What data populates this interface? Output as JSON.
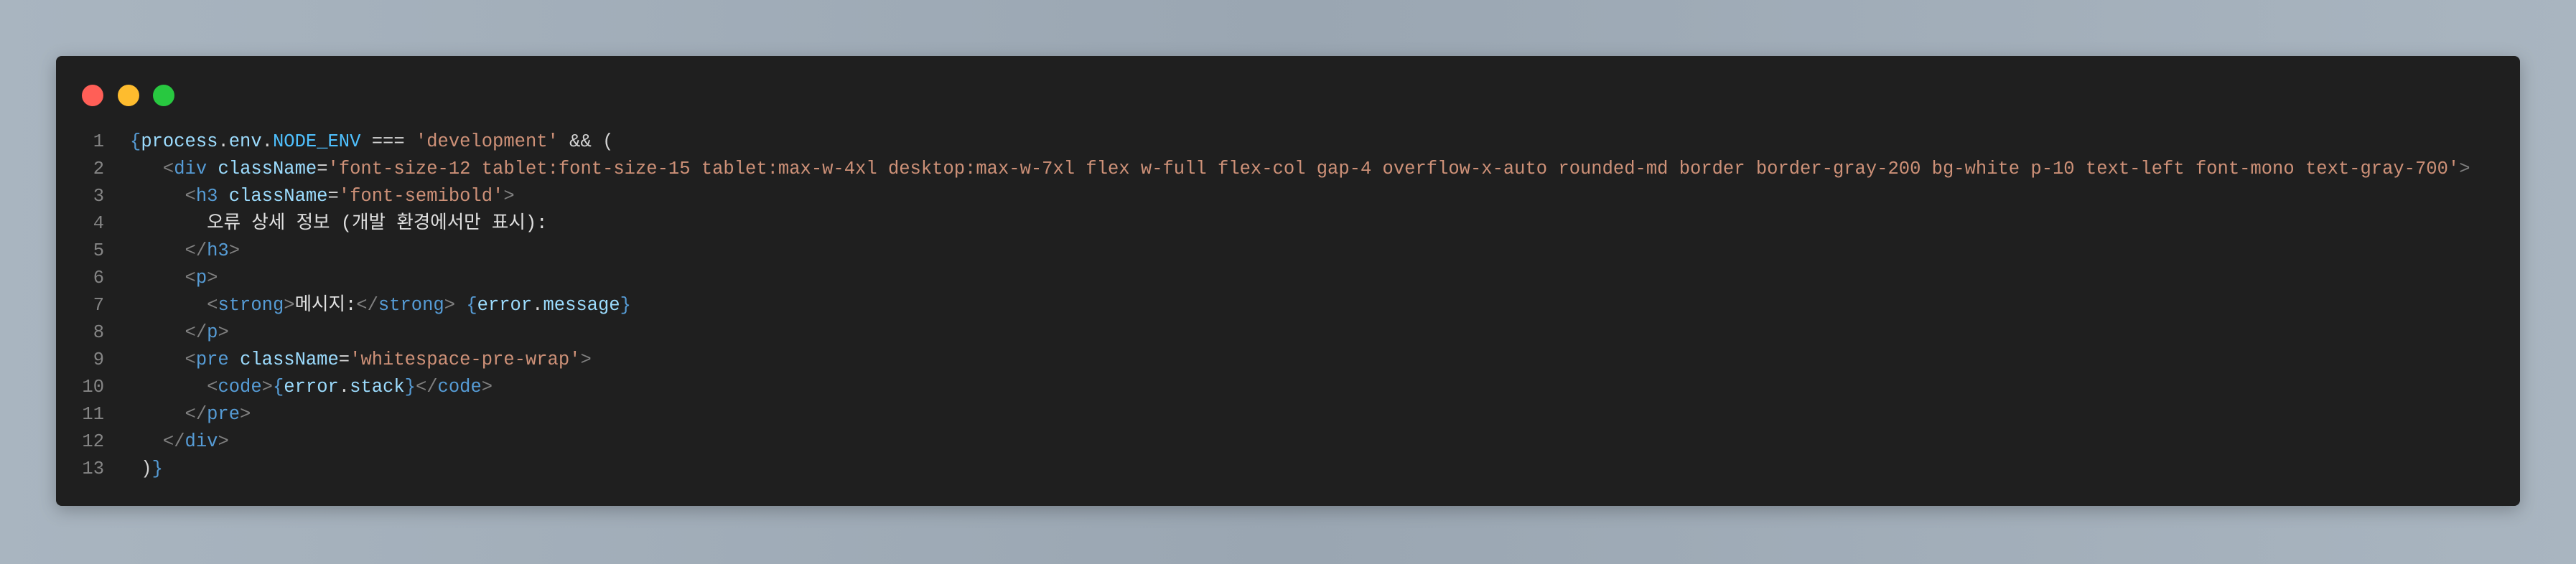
{
  "window": {
    "controls": [
      "close",
      "minimize",
      "maximize"
    ]
  },
  "colors": {
    "background": "#1f1f1f",
    "tag": "#569cd6",
    "attr": "#9cdcfe",
    "string": "#ce9178",
    "bracket": "#808080",
    "text": "#d4d4d4"
  },
  "lines": [
    {
      "n": "1",
      "tokens": [
        [
          "brace",
          "{"
        ],
        [
          "var",
          "process"
        ],
        [
          "punct",
          "."
        ],
        [
          "var",
          "env"
        ],
        [
          "punct",
          "."
        ],
        [
          "const",
          "NODE_ENV"
        ],
        [
          "punct",
          " === "
        ],
        [
          "str",
          "'development'"
        ],
        [
          "punct",
          " && ("
        ]
      ]
    },
    {
      "n": "2",
      "tokens": [
        [
          "punct",
          "   "
        ],
        [
          "bracket",
          "<"
        ],
        [
          "tag",
          "div"
        ],
        [
          "punct",
          " "
        ],
        [
          "attr",
          "className"
        ],
        [
          "punct",
          "="
        ],
        [
          "str",
          "'font-size-12 tablet:font-size-15 tablet:max-w-4xl desktop:max-w-7xl flex w-full flex-col gap-4 overflow-x-auto rounded-md border border-gray-200 bg-white p-10 text-left font-mono text-gray-700'"
        ],
        [
          "bracket",
          ">"
        ]
      ]
    },
    {
      "n": "3",
      "tokens": [
        [
          "punct",
          "     "
        ],
        [
          "bracket",
          "<"
        ],
        [
          "tag",
          "h3"
        ],
        [
          "punct",
          " "
        ],
        [
          "attr",
          "className"
        ],
        [
          "punct",
          "="
        ],
        [
          "str",
          "'font-semibold'"
        ],
        [
          "bracket",
          ">"
        ]
      ]
    },
    {
      "n": "4",
      "tokens": [
        [
          "punct",
          "       "
        ],
        [
          "text",
          "오류 상세 정보 (개발 환경에서만 표시):"
        ]
      ]
    },
    {
      "n": "5",
      "tokens": [
        [
          "punct",
          "     "
        ],
        [
          "bracket",
          "</"
        ],
        [
          "tag",
          "h3"
        ],
        [
          "bracket",
          ">"
        ]
      ]
    },
    {
      "n": "6",
      "tokens": [
        [
          "punct",
          "     "
        ],
        [
          "bracket",
          "<"
        ],
        [
          "tag",
          "p"
        ],
        [
          "bracket",
          ">"
        ]
      ]
    },
    {
      "n": "7",
      "tokens": [
        [
          "punct",
          "       "
        ],
        [
          "bracket",
          "<"
        ],
        [
          "tag",
          "strong"
        ],
        [
          "bracket",
          ">"
        ],
        [
          "text",
          "메시지:"
        ],
        [
          "bracket",
          "</"
        ],
        [
          "tag",
          "strong"
        ],
        [
          "bracket",
          ">"
        ],
        [
          "punct",
          " "
        ],
        [
          "brace",
          "{"
        ],
        [
          "var",
          "error"
        ],
        [
          "punct",
          "."
        ],
        [
          "var",
          "message"
        ],
        [
          "brace",
          "}"
        ]
      ]
    },
    {
      "n": "8",
      "tokens": [
        [
          "punct",
          "     "
        ],
        [
          "bracket",
          "</"
        ],
        [
          "tag",
          "p"
        ],
        [
          "bracket",
          ">"
        ]
      ]
    },
    {
      "n": "9",
      "tokens": [
        [
          "punct",
          "     "
        ],
        [
          "bracket",
          "<"
        ],
        [
          "tag",
          "pre"
        ],
        [
          "punct",
          " "
        ],
        [
          "attr",
          "className"
        ],
        [
          "punct",
          "="
        ],
        [
          "str",
          "'whitespace-pre-wrap'"
        ],
        [
          "bracket",
          ">"
        ]
      ]
    },
    {
      "n": "10",
      "tokens": [
        [
          "punct",
          "       "
        ],
        [
          "bracket",
          "<"
        ],
        [
          "tag",
          "code"
        ],
        [
          "bracket",
          ">"
        ],
        [
          "brace",
          "{"
        ],
        [
          "var",
          "error"
        ],
        [
          "punct",
          "."
        ],
        [
          "var",
          "stack"
        ],
        [
          "brace",
          "}"
        ],
        [
          "bracket",
          "</"
        ],
        [
          "tag",
          "code"
        ],
        [
          "bracket",
          ">"
        ]
      ]
    },
    {
      "n": "11",
      "tokens": [
        [
          "punct",
          "     "
        ],
        [
          "bracket",
          "</"
        ],
        [
          "tag",
          "pre"
        ],
        [
          "bracket",
          ">"
        ]
      ]
    },
    {
      "n": "12",
      "tokens": [
        [
          "punct",
          "   "
        ],
        [
          "bracket",
          "</"
        ],
        [
          "tag",
          "div"
        ],
        [
          "bracket",
          ">"
        ]
      ]
    },
    {
      "n": "13",
      "tokens": [
        [
          "punct",
          " )"
        ],
        [
          "brace",
          "}"
        ]
      ]
    }
  ]
}
